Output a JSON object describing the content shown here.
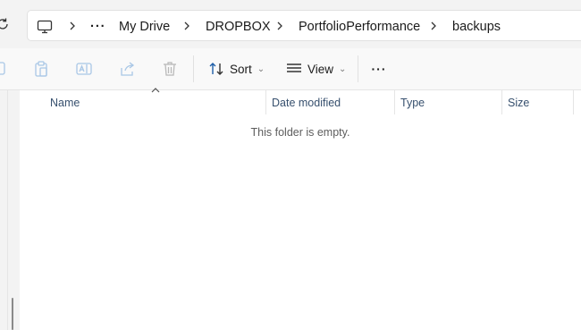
{
  "breadcrumb": {
    "items": [
      "My Drive",
      "DROPBOX",
      "PortfolioPerformance",
      "backups"
    ],
    "overflow_label": "···"
  },
  "toolbar": {
    "sort_label": "Sort",
    "view_label": "View",
    "more_label": "···"
  },
  "list": {
    "columns": [
      "Name",
      "Date modified",
      "Type",
      "Size"
    ],
    "empty_message": "This folder is empty."
  }
}
